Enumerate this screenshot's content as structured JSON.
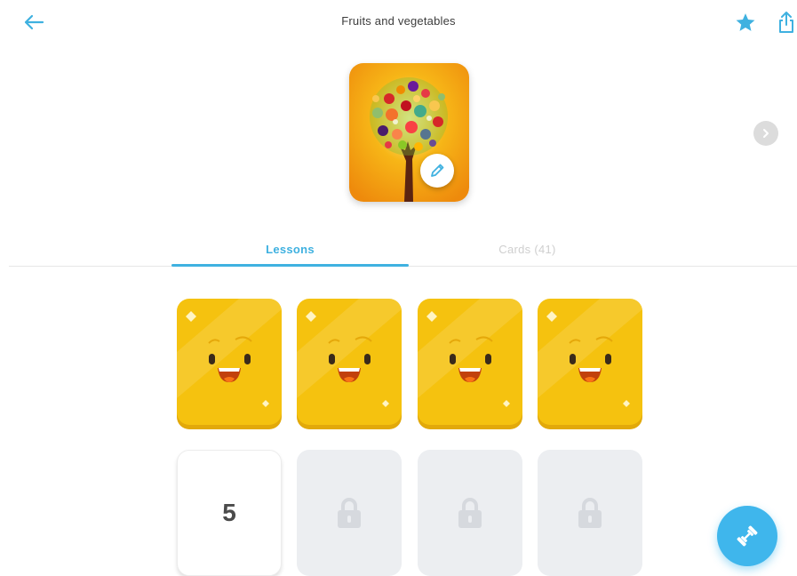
{
  "header": {
    "title": "Fruits and vegetables",
    "back_icon": "back-arrow-icon",
    "favorite_icon": "star-icon",
    "share_icon": "share-icon"
  },
  "cover": {
    "image": "fruit-tree-image",
    "edit_icon": "pencil-icon",
    "next_icon": "chevron-right-icon"
  },
  "tabs": [
    {
      "label": "Lessons",
      "active": true
    },
    {
      "label": "Cards (41)",
      "active": false
    }
  ],
  "lessons": [
    {
      "state": "completed",
      "icon": "smiley-card-icon"
    },
    {
      "state": "completed",
      "icon": "smiley-card-icon"
    },
    {
      "state": "completed",
      "icon": "smiley-card-icon"
    },
    {
      "state": "completed",
      "icon": "smiley-card-icon"
    },
    {
      "state": "current",
      "number": "5"
    },
    {
      "state": "locked",
      "icon": "lock-icon"
    },
    {
      "state": "locked",
      "icon": "lock-icon"
    },
    {
      "state": "locked",
      "icon": "lock-icon"
    }
  ],
  "fab": {
    "icon": "dumbbell-icon"
  },
  "colors": {
    "accent": "#3fb1e0",
    "gold": "#f5c20f",
    "locked": "#eceef1"
  }
}
